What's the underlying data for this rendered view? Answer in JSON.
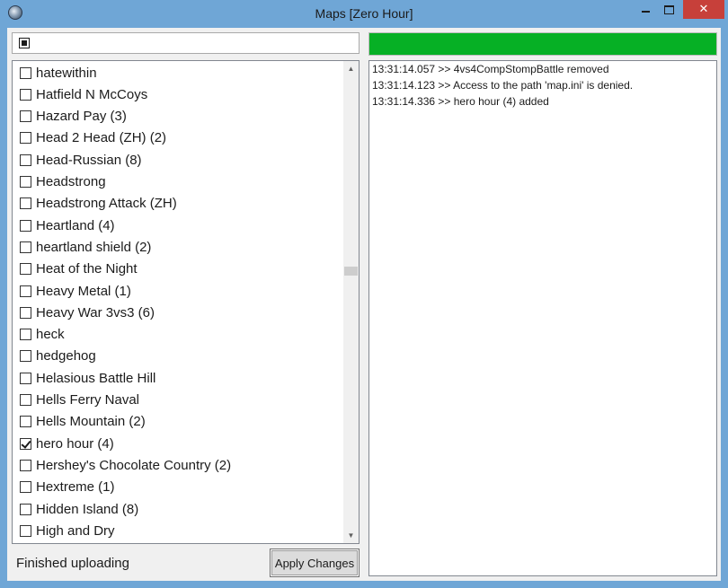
{
  "window": {
    "title": "Maps [Zero Hour]",
    "close_glyph": "✕"
  },
  "search": {
    "value": ""
  },
  "progress": {
    "percent": 100,
    "color": "#06b025"
  },
  "maps": [
    {
      "label": "hatewithin",
      "checked": false
    },
    {
      "label": "Hatfield N McCoys",
      "checked": false
    },
    {
      "label": "Hazard Pay (3)",
      "checked": false
    },
    {
      "label": "Head 2 Head (ZH) (2)",
      "checked": false
    },
    {
      "label": "Head-Russian (8)",
      "checked": false
    },
    {
      "label": "Headstrong",
      "checked": false
    },
    {
      "label": "Headstrong Attack (ZH)",
      "checked": false
    },
    {
      "label": "Heartland (4)",
      "checked": false
    },
    {
      "label": "heartland shield (2)",
      "checked": false
    },
    {
      "label": "Heat of the Night",
      "checked": false
    },
    {
      "label": "Heavy Metal (1)",
      "checked": false
    },
    {
      "label": "Heavy War 3vs3 (6)",
      "checked": false
    },
    {
      "label": "heck",
      "checked": false
    },
    {
      "label": "hedgehog",
      "checked": false
    },
    {
      "label": "Helasious Battle Hill",
      "checked": false
    },
    {
      "label": "Hells Ferry Naval",
      "checked": false
    },
    {
      "label": "Hells Mountain (2)",
      "checked": false
    },
    {
      "label": "hero hour (4)",
      "checked": true
    },
    {
      "label": "Hershey's Chocolate Country (2)",
      "checked": false
    },
    {
      "label": "Hextreme (1)",
      "checked": false
    },
    {
      "label": "Hidden Island (8)",
      "checked": false
    },
    {
      "label": "High and Dry",
      "checked": false
    }
  ],
  "status": {
    "text": "Finished uploading"
  },
  "apply_button": {
    "label": "Apply Changes"
  },
  "log": [
    "13:31:14.057 >> 4vs4CompStompBattle removed",
    "13:31:14.123 >> Access to the path 'map.ini' is denied.",
    "13:31:14.336 >> hero hour (4) added"
  ],
  "icons": {
    "app": "globe-icon",
    "stop": "stop-icon",
    "scroll_up": "▲",
    "scroll_down": "▼"
  }
}
